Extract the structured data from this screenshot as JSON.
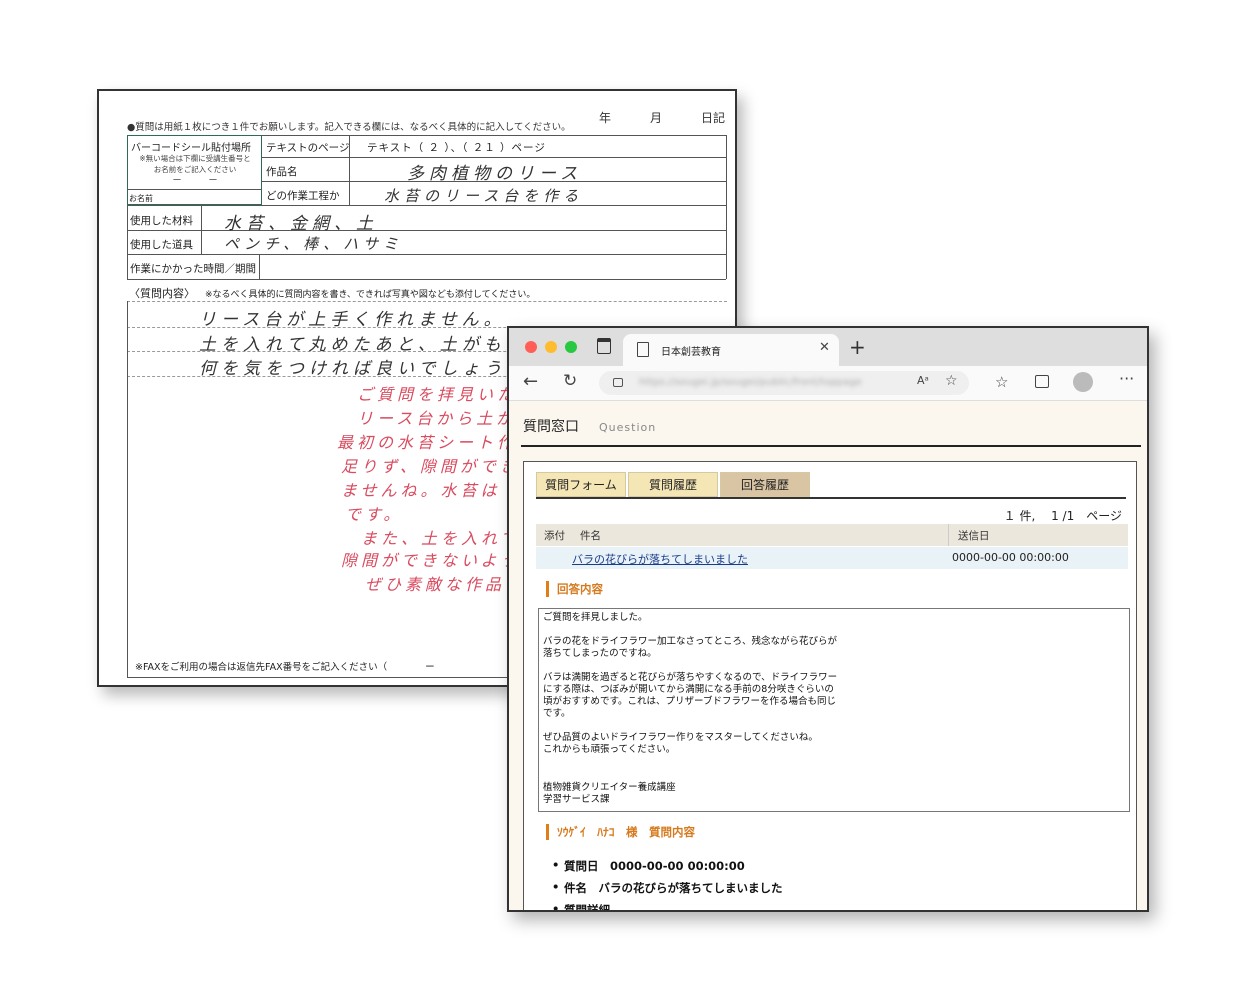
{
  "form": {
    "note": "●質問は用紙１枚につき１件でお願いします。記入できる欄には、なるべく具体的に記入してください。",
    "date": {
      "year": "年",
      "month": "月",
      "day": "日記"
    },
    "barcode_label": "バーコードシール貼付場所",
    "barcode_note": "※無い場合は下欄に受講生番号と\nお名前をご記入ください",
    "barcode_dash": "ー　　　ー",
    "name_label": "お名前",
    "rows": {
      "text_page_label": "テキストのページ",
      "text_page_value": "テキスト（ ２ ）、（ ２１ ）ページ",
      "work_label": "作品名",
      "work_value": "多肉植物のリース",
      "step_label": "どの作業工程か",
      "step_value": "水苔のリース台を作る",
      "materials_label": "使用した材料",
      "materials_value": "水苔、金網、土",
      "tools_label": "使用した道具",
      "tools_value": "ペンチ、棒、ハサミ",
      "time_label": "作業にかかった時間／期間"
    },
    "question_label": "〈質問内容〉",
    "question_note": "※なるべく具体的に質問内容を書き、できれば写真や図なども添付してください。",
    "question_lines": [
      "リース台が上手く作れません。",
      "土を入れて丸めたあと、土がも",
      "何を気をつければ良いでしょうか"
    ],
    "answer_lines": [
      "ご質問を拝見いた",
      "リース台から土が",
      "最初の水苔シート作",
      "足りず、隙間ができ",
      "ませんね。水苔は",
      "です。",
      "また、土を入れて",
      "隙間ができないよう",
      "ぜひ素敵な作品"
    ],
    "fax_note": "※FAXをご利用の場合は返信先FAX番号をご記入ください（　　　　ー"
  },
  "browser": {
    "tab_title": "日本創芸教育",
    "url": "https://sougei.jp/sougei/public/front/toppage",
    "icons": [
      "window-icon",
      "tab-page-icon",
      "close-icon",
      "new-tab-icon",
      "back-icon",
      "reload-icon",
      "lock-icon",
      "read-aloud-icon",
      "add-favorite-icon",
      "favorites-icon",
      "collections-icon",
      "profile-icon",
      "more-icon"
    ],
    "page_title": "質問窓口",
    "page_subtitle": "Question",
    "tabs": [
      {
        "label": "質問フォーム",
        "active": false
      },
      {
        "label": "質問履歴",
        "active": false
      },
      {
        "label": "回答履歴",
        "active": true
      }
    ],
    "pager": "１ 件,　 1 /1　ページ",
    "table": {
      "headers": {
        "attach": "添付",
        "subject": "件名",
        "sent": "送信日"
      },
      "row": {
        "subject": "バラの花びらが落ちてしまいました",
        "sent": "0000-00-00 00:00:00"
      }
    },
    "answer_heading": "回答内容",
    "answer_paragraphs": [
      "ご質問を拝見しました。",
      "バラの花をドライフラワー加工なさってところ、残念ながら花びらが\n落ちてしまったのですね。",
      "バラは満開を過ぎると花びらが落ちやすくなるので、ドライフラワー\nにする際は、つぼみが開いてから満開になる手前の8分咲きぐらいの\n頃がおすすめです。これは、プリザーブドフラワーを作る場合も同じ\nです。",
      "ぜひ品質のよいドライフラワー作りをマスターしてくださいね。\nこれからも頑張ってください。",
      "植物雑貨クリエイター養成講座\n学習サービス課"
    ],
    "question_heading": "ｿｳｹﾞｲ　ﾊﾅｺ　様　質問内容",
    "question_items": [
      "質問日　0000-00-00 00:00:00",
      "件名　バラの花びらが落ちてしまいました",
      "質問詳細"
    ],
    "colors": {
      "accent": "#e07d16",
      "tab": "#f5e6b5",
      "tab_active": "#d9c4a3",
      "link": "#1a3c8c",
      "handwriting_red": "#d94b5f"
    }
  }
}
